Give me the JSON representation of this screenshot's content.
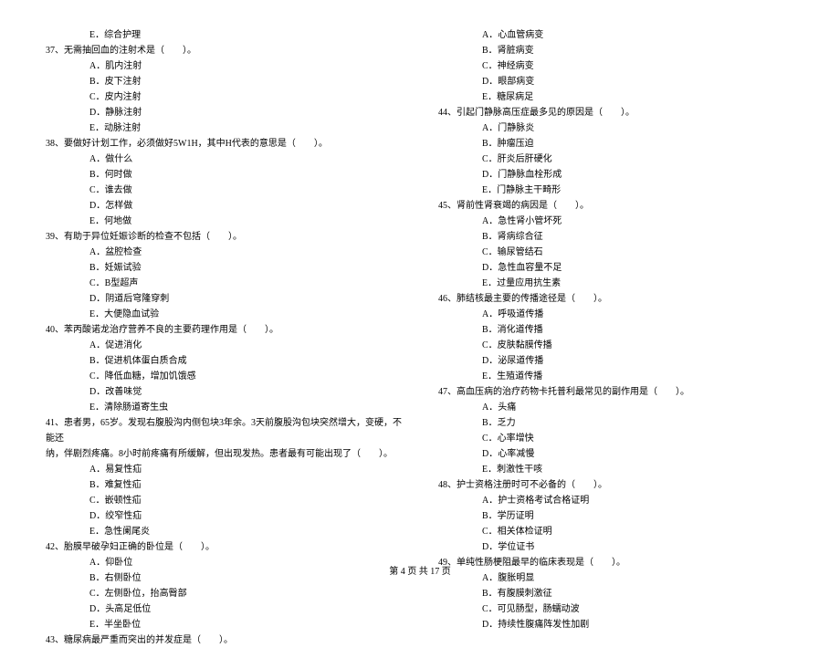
{
  "col1": [
    {
      "cls": "option",
      "t": "E．综合护理"
    },
    {
      "cls": "question",
      "t": "37、无需抽回血的注射术是（　　）。"
    },
    {
      "cls": "option",
      "t": "A．肌内注射"
    },
    {
      "cls": "option",
      "t": "B．皮下注射"
    },
    {
      "cls": "option",
      "t": "C．皮内注射"
    },
    {
      "cls": "option",
      "t": "D．静脉注射"
    },
    {
      "cls": "option",
      "t": "E．动脉注射"
    },
    {
      "cls": "question",
      "t": "38、要做好计划工作，必须做好5W1H，其中H代表的意思是（　　）。"
    },
    {
      "cls": "option",
      "t": "A．做什么"
    },
    {
      "cls": "option",
      "t": "B．何时做"
    },
    {
      "cls": "option",
      "t": "C．谁去做"
    },
    {
      "cls": "option",
      "t": "D．怎样做"
    },
    {
      "cls": "option",
      "t": "E．何地做"
    },
    {
      "cls": "question",
      "t": "39、有助于异位妊娠诊断的检查不包括（　　）。"
    },
    {
      "cls": "option",
      "t": "A．盆腔检查"
    },
    {
      "cls": "option",
      "t": "B．妊娠试验"
    },
    {
      "cls": "option",
      "t": "C．B型超声"
    },
    {
      "cls": "option",
      "t": "D．阴道后穹隆穿刺"
    },
    {
      "cls": "option",
      "t": "E．大便隐血试验"
    },
    {
      "cls": "question",
      "t": "40、苯丙酸诺龙治疗营养不良的主要药理作用是（　　）。"
    },
    {
      "cls": "option",
      "t": "A．促进消化"
    },
    {
      "cls": "option",
      "t": "B．促进机体蛋白质合成"
    },
    {
      "cls": "option",
      "t": "C．降低血糖，增加饥饿感"
    },
    {
      "cls": "option",
      "t": "D．改善味觉"
    },
    {
      "cls": "option",
      "t": "E．清除肠道寄生虫"
    },
    {
      "cls": "question",
      "t": "41、患者男，65岁。发现右腹股沟内侧包块3年余。3天前腹股沟包块突然增大，变硬，不能还"
    },
    {
      "cls": "question",
      "t": "纳，伴剧烈疼痛。8小时前疼痛有所缓解，但出现发热。患者最有可能出现了（　　）。"
    },
    {
      "cls": "option",
      "t": "A．易复性疝"
    },
    {
      "cls": "option",
      "t": "B．难复性疝"
    },
    {
      "cls": "option",
      "t": "C．嵌顿性疝"
    },
    {
      "cls": "option",
      "t": "D．绞窄性疝"
    },
    {
      "cls": "option",
      "t": "E．急性阑尾炎"
    },
    {
      "cls": "question",
      "t": "42、胎膜早破孕妇正确的卧位是（　　）。"
    },
    {
      "cls": "option",
      "t": "A．仰卧位"
    },
    {
      "cls": "option",
      "t": "B．右侧卧位"
    },
    {
      "cls": "option",
      "t": "C．左侧卧位，抬高臀部"
    },
    {
      "cls": "option",
      "t": "D．头高足低位"
    },
    {
      "cls": "option",
      "t": "E．半坐卧位"
    },
    {
      "cls": "question",
      "t": "43、糖尿病最严重而突出的并发症是（　　）。"
    }
  ],
  "col2": [
    {
      "cls": "option",
      "t": "A．心血管病变"
    },
    {
      "cls": "option",
      "t": "B．肾脏病变"
    },
    {
      "cls": "option",
      "t": "C．神经病变"
    },
    {
      "cls": "option",
      "t": "D．眼部病变"
    },
    {
      "cls": "option",
      "t": "E．糖尿病足"
    },
    {
      "cls": "question",
      "t": "44、引起门静脉高压症最多见的原因是（　　）。"
    },
    {
      "cls": "option",
      "t": "A．门静脉炎"
    },
    {
      "cls": "option",
      "t": "B．肿瘤压迫"
    },
    {
      "cls": "option",
      "t": "C．肝炎后肝硬化"
    },
    {
      "cls": "option",
      "t": "D．门静脉血栓形成"
    },
    {
      "cls": "option",
      "t": "E．门静脉主干畸形"
    },
    {
      "cls": "question",
      "t": "45、肾前性肾衰竭的病因是（　　）。"
    },
    {
      "cls": "option",
      "t": "A．急性肾小管坏死"
    },
    {
      "cls": "option",
      "t": "B．肾病综合征"
    },
    {
      "cls": "option",
      "t": "C．输尿管结石"
    },
    {
      "cls": "option",
      "t": "D．急性血容量不足"
    },
    {
      "cls": "option",
      "t": "E．过量应用抗生素"
    },
    {
      "cls": "question",
      "t": "46、肺结核最主要的传播途径是（　　）。"
    },
    {
      "cls": "option",
      "t": "A．呼吸道传播"
    },
    {
      "cls": "option",
      "t": "B．消化道传播"
    },
    {
      "cls": "option",
      "t": "C．皮肤黏膜传播"
    },
    {
      "cls": "option",
      "t": "D．泌尿道传播"
    },
    {
      "cls": "option",
      "t": "E．生殖道传播"
    },
    {
      "cls": "question",
      "t": "47、高血压病的治疗药物卡托普利最常见的副作用是（　　）。"
    },
    {
      "cls": "option",
      "t": "A．头痛"
    },
    {
      "cls": "option",
      "t": "B．乏力"
    },
    {
      "cls": "option",
      "t": "C．心率增快"
    },
    {
      "cls": "option",
      "t": "D．心率减慢"
    },
    {
      "cls": "option",
      "t": "E．刺激性干咳"
    },
    {
      "cls": "question",
      "t": "48、护士资格注册时可不必备的（　　）。"
    },
    {
      "cls": "option",
      "t": "A．护士资格考试合格证明"
    },
    {
      "cls": "option",
      "t": "B．学历证明"
    },
    {
      "cls": "option",
      "t": "C．相关体检证明"
    },
    {
      "cls": "option",
      "t": "D．学位证书"
    },
    {
      "cls": "question",
      "t": "49、单纯性肠梗阻最早的临床表现是（　　）。"
    },
    {
      "cls": "option",
      "t": "A．腹胀明显"
    },
    {
      "cls": "option",
      "t": "B．有腹膜刺激征"
    },
    {
      "cls": "option",
      "t": "C．可见肠型，肠蠕动波"
    },
    {
      "cls": "option",
      "t": "D．持续性腹痛阵发性加剧"
    }
  ],
  "footer": "第 4 页 共 17 页"
}
